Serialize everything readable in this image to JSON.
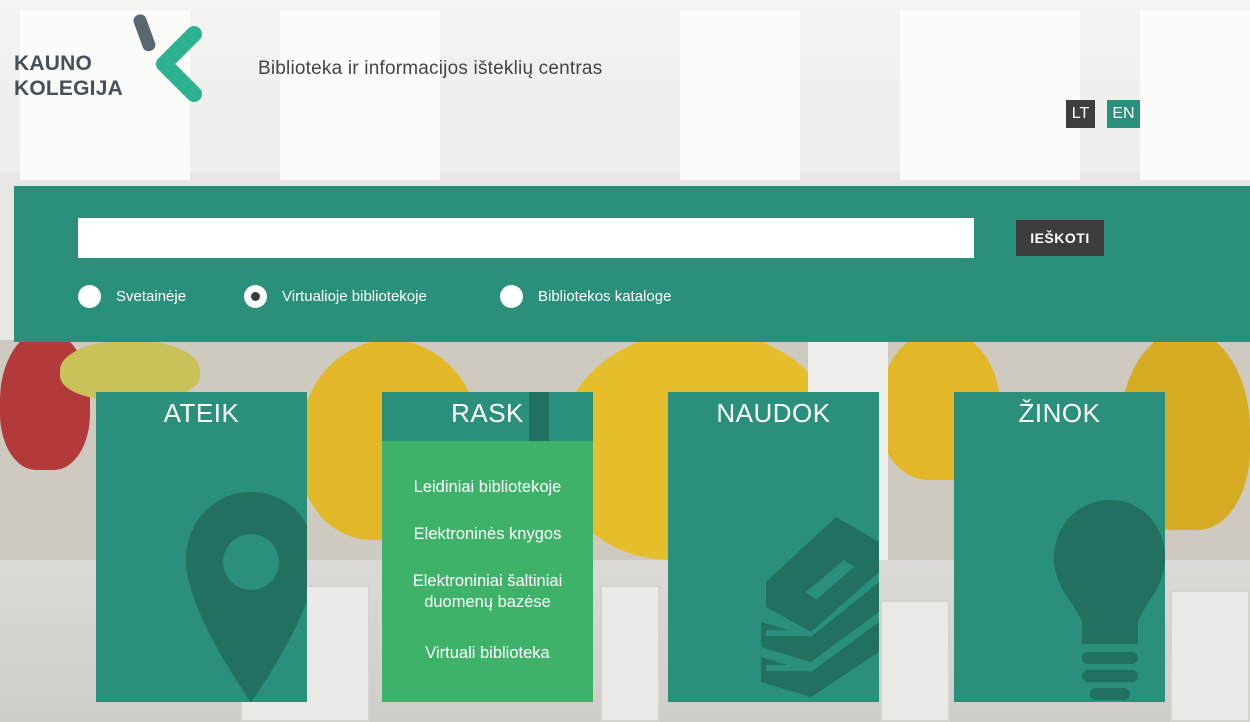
{
  "header": {
    "logo_line1": "KAUNO",
    "logo_line2": "KOLEGIJA",
    "subtitle": "Biblioteka ir informacijos išteklių centras",
    "lang_lt": "LT",
    "lang_en": "EN"
  },
  "search": {
    "value": "",
    "placeholder": "",
    "button_label": "IEŠKOTI",
    "scopes": [
      {
        "label": "Svetainėje",
        "selected": false
      },
      {
        "label": "Virtualioje bibliotekoje",
        "selected": true
      },
      {
        "label": "Bibliotekos kataloge",
        "selected": false
      }
    ]
  },
  "tiles": [
    {
      "title": "ATEIK",
      "icon": "map-pin-icon"
    },
    {
      "title": "RASK",
      "icon": "",
      "menu": [
        "Leidiniai bibliotekoje",
        "Elektroninės knygos",
        "Elektroniniai šaltiniai duomenų bazėse",
        "Virtuali biblioteka"
      ]
    },
    {
      "title": "NAUDOK",
      "icon": "book-stack-icon"
    },
    {
      "title": "ŽINOK",
      "icon": "light-bulb-icon"
    }
  ],
  "colors": {
    "teal": "#2a8f7b",
    "teal_dark": "#22705f",
    "green_menu": "#3fb26a",
    "dark_button": "#3d3d3d"
  }
}
